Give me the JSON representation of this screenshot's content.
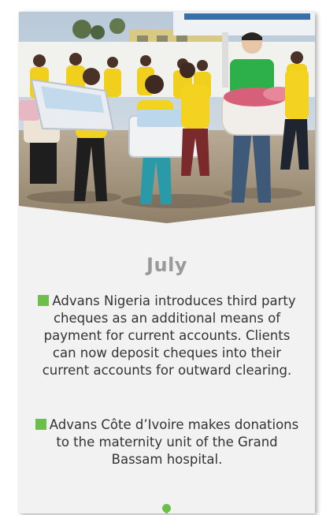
{
  "month": "July",
  "accent_color": "#6cc04a",
  "photo": {
    "description_icon": "photo-image"
  },
  "news": [
    {
      "text": "Advans Nigeria introduces third party cheques as an additional means of payment for current accounts. Clients can now deposit cheques into their current accounts for outward clearing."
    },
    {
      "text": "Advans Côte d’Ivoire makes donations to the maternity unit of the Grand Bassam hospital."
    }
  ]
}
